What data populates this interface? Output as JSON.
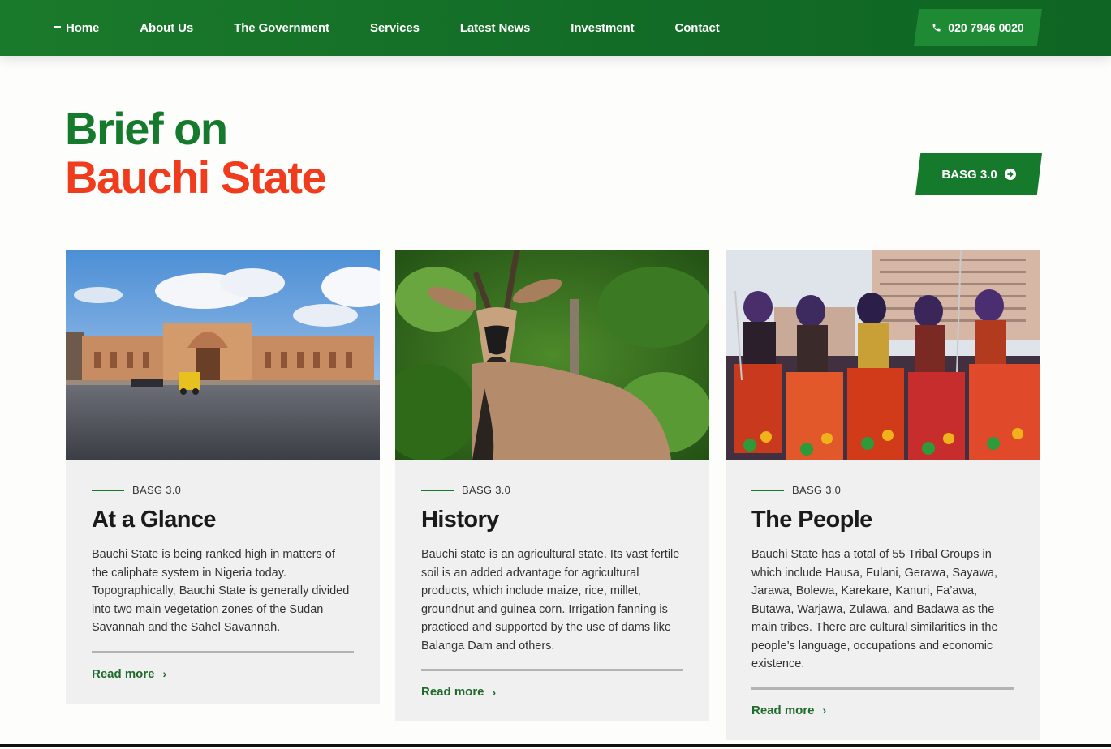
{
  "nav": {
    "items": [
      {
        "label": "Home",
        "active": true
      },
      {
        "label": "About Us"
      },
      {
        "label": "The Government"
      },
      {
        "label": "Services"
      },
      {
        "label": "Latest News"
      },
      {
        "label": "Investment"
      },
      {
        "label": "Contact"
      }
    ],
    "phone": "020 7946 0020",
    "phone_icon": "phone-icon"
  },
  "hero": {
    "title_line1": "Brief on",
    "title_line2": "Bauchi State",
    "button_label": "BASG 3.0",
    "button_icon": "arrow-right-circle-icon"
  },
  "cards": [
    {
      "tag": "BASG 3.0",
      "title": "At a Glance",
      "text": "Bauchi State is being ranked high in matters of the caliphate system in Nigeria today. Topographically, Bauchi State is generally divided into two main vegetation zones of the Sudan Savannah and the Sahel Savannah.",
      "link": "Read more"
    },
    {
      "tag": "BASG 3.0",
      "title": "History",
      "text": "Bauchi state is an agricultural state. Its vast fertile soil is an added advantage for agricultural products, which include maize, rice, millet, groundnut and guinea corn. Irrigation fanning is practiced and supported by the use of dams like Balanga Dam and others.",
      "link": "Read more"
    },
    {
      "tag": "BASG 3.0",
      "title": "The People",
      "text": "Bauchi State has a total of 55 Tribal Groups in which include Hausa, Fulani, Gerawa, Sayawa, Jarawa, Bolewa, Karekare, Kanuri, Fa’awa, Butawa, Warjawa, Zulawa, and Badawa as the main tribes. There are cultural similarities in the people’s language, occupations and economic existence.",
      "link": "Read more"
    }
  ],
  "colors": {
    "primary_green": "#157a2c",
    "accent_red": "#f03c1c",
    "card_bg": "#f0f0f0"
  }
}
